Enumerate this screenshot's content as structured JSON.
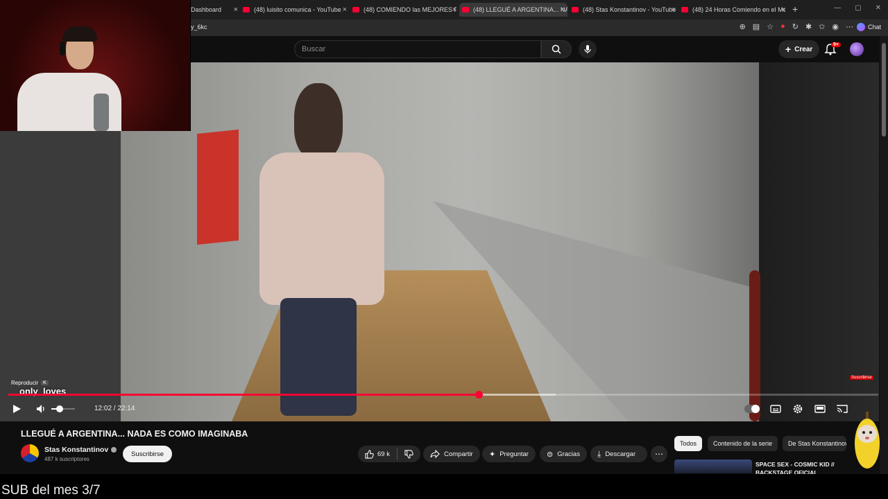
{
  "browser": {
    "tabs": [
      {
        "label": "Dashboard",
        "active": false,
        "has_favicon": false
      },
      {
        "label": "(48) luisito comunica - YouTube",
        "active": false,
        "has_favicon": true
      },
      {
        "label": "(48) COMIENDO las MEJORES PIZ...",
        "active": false,
        "has_favicon": true
      },
      {
        "label": "(48) LLEGUÉ A ARGENTINA... NAD",
        "active": true,
        "has_favicon": true
      },
      {
        "label": "(48) Stas Konstantinov - YouTube",
        "active": false,
        "has_favicon": true
      },
      {
        "label": "(48) 24 Horas Comiendo en el Me",
        "active": false,
        "has_favicon": true
      }
    ],
    "new_tab_symbol": "+",
    "address": "y_6kc",
    "chat_label": "Chat"
  },
  "youtube_header": {
    "search_placeholder": "Buscar",
    "create_label": "Crear",
    "notifications_badge": "9+"
  },
  "player": {
    "tooltip_label": "Reproducir",
    "tooltip_key": "K",
    "overlay_username": "only_loves",
    "current_time": "12:02",
    "duration": "22:14",
    "time_display": "12:02 / 22:14",
    "progress_fraction": 0.541,
    "volume_fraction": 0.35,
    "sub_badge": "Suscribirse",
    "accent_color": "#ff0033"
  },
  "video_info": {
    "title": "LLEGUÉ A ARGENTINA... NADA ES COMO IMAGINABA",
    "channel_name": "Stas Konstantinov",
    "subscribers": "487 k suscriptores",
    "subscribe_label": "Suscribirse",
    "likes": "69 k",
    "share_label": "Compartir",
    "ask_label": "Preguntar",
    "thanks_label": "Gracias",
    "download_label": "Descargar"
  },
  "sidebar": {
    "chips": [
      "Todos",
      "Contenido de la serie",
      "De Stas Konstantinov"
    ],
    "recommendation_title": "SPACE SEX - COSMIC KID // BACKSTAGE OFICIAL"
  },
  "stream_overlay": {
    "bottom_caption": "SUB del mes 3/7"
  }
}
